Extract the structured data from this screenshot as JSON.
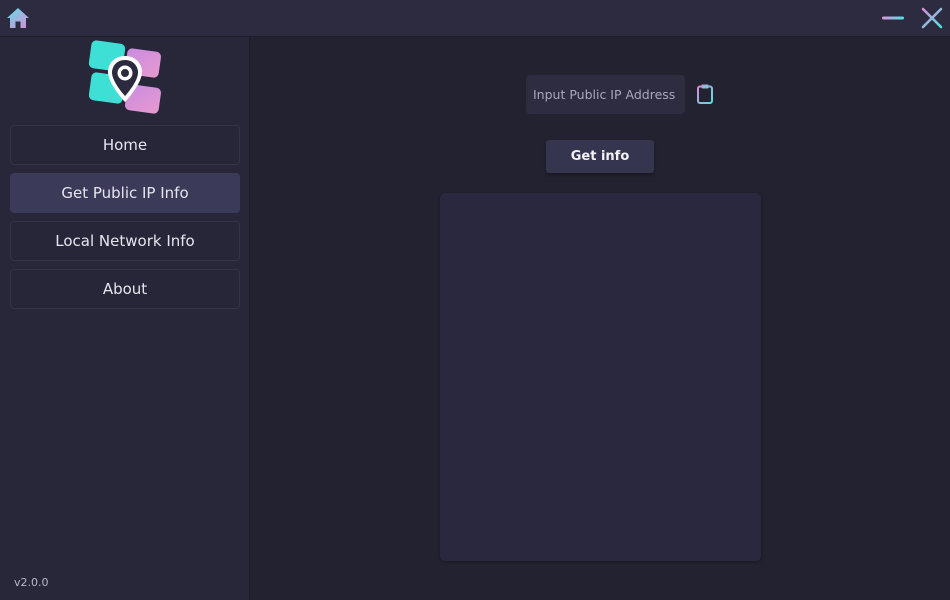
{
  "titlebar": {
    "home_icon": "home-icon",
    "minimize_icon": "minimize-icon",
    "close_icon": "close-icon",
    "colors": {
      "cyan": "#4fe3e0",
      "pink": "#d68fd6"
    }
  },
  "sidebar": {
    "logo_icon": "location-pin-icon",
    "items": [
      {
        "label": "Home",
        "active": false
      },
      {
        "label": "Get Public IP Info",
        "active": true
      },
      {
        "label": "Local Network Info",
        "active": false
      },
      {
        "label": "About",
        "active": false
      }
    ],
    "version": "v2.0.0"
  },
  "main": {
    "ip_input": {
      "value": "",
      "placeholder": "Input Public IP Address"
    },
    "paste_icon": "clipboard-icon",
    "get_info_label": "Get info",
    "result_text": ""
  },
  "colors": {
    "background": "#232230",
    "sidebar": "#28273a",
    "titlebar": "#2c2b3f",
    "active_item": "#3b3a58",
    "button": "#36354f",
    "panel": "#29283e"
  }
}
